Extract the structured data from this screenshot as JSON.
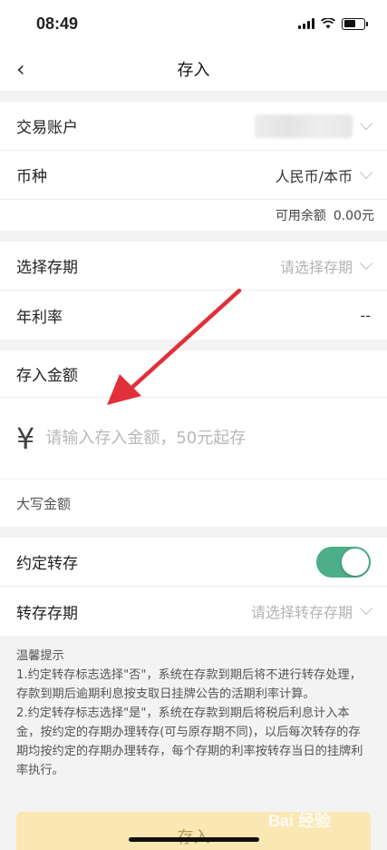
{
  "status_bar": {
    "time": "08:49"
  },
  "header": {
    "title": "存入",
    "back_icon": "‹"
  },
  "account": {
    "trade_account_label": "交易账户",
    "currency_label": "币种",
    "currency_value": "人民币/本币",
    "available_label": "可用余额",
    "available_value": "0.00元"
  },
  "term": {
    "select_term_label": "选择存期",
    "select_term_placeholder": "请选择存期",
    "rate_label": "年利率",
    "rate_value": "--"
  },
  "amount": {
    "label": "存入金额",
    "currency_symbol": "¥",
    "placeholder": "请输入存入金额，50元起存",
    "upper_label": "大写金额"
  },
  "renewal": {
    "agreed_label": "约定转存",
    "agreed_on": true,
    "term_label": "转存存期",
    "term_placeholder": "请选择转存存期"
  },
  "tips": {
    "title": "温馨提示",
    "lines": [
      "1.约定转存标志选择\"否\"，系统在存款到期后将不进行转存处理，存款到期后逾期利息按支取日挂牌公告的活期利率计算。",
      "2.约定转存标志选择\"是\"，系统在存款到期后将税后利息计入本金，按约定的存期办理转存(可与原存期不同)，以后每次转存的存期均按约定的存期办理转存，每个存期的利率按转存当日的挂牌利率执行。"
    ]
  },
  "submit_label": "存入",
  "watermark_text": "Bai 经验",
  "colors": {
    "toggle_on": "#4caf8a",
    "submit_bg": "#fbe7b3",
    "annotation_arrow": "#e0303a"
  }
}
